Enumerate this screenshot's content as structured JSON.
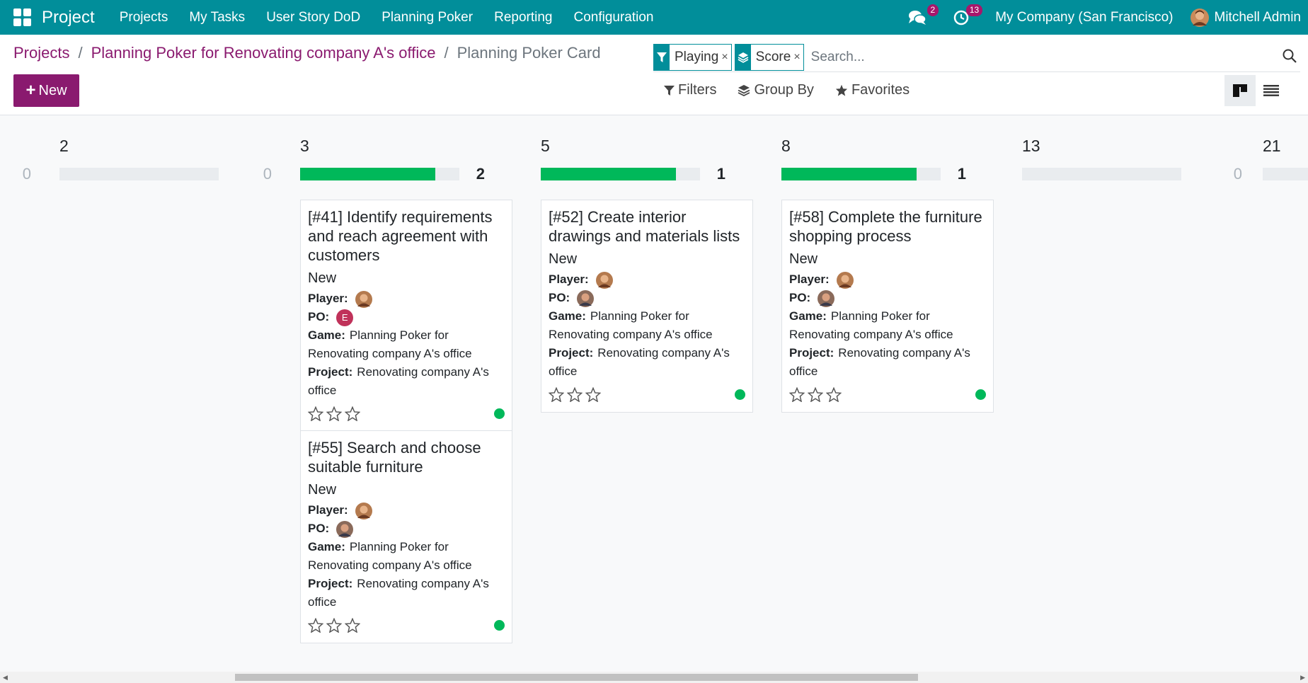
{
  "navbar": {
    "app_name": "Project",
    "menu": [
      "Projects",
      "My Tasks",
      "User Story DoD",
      "Planning Poker",
      "Reporting",
      "Configuration"
    ],
    "messages_badge": "2",
    "activities_badge": "13",
    "company": "My Company (San Francisco)",
    "user": "Mitchell Admin"
  },
  "breadcrumb": {
    "root": "Projects",
    "parent": "Planning Poker for Renovating company A's office",
    "current": "Planning Poker Card"
  },
  "search": {
    "facets": [
      "Playing",
      "Score"
    ],
    "facet_remove": "×",
    "placeholder": "Search..."
  },
  "toolbar": {
    "new_label": "New",
    "filters_label": "Filters",
    "groupby_label": "Group By",
    "favorites_label": "Favorites"
  },
  "columns": [
    {
      "title": "2",
      "count": "0",
      "progress": 0
    },
    {
      "title": "3",
      "count": "2",
      "progress": 1.0
    },
    {
      "title": "5",
      "count": "1",
      "progress": 1.0
    },
    {
      "title": "8",
      "count": "1",
      "progress": 1.0
    },
    {
      "title": "13",
      "count": "0",
      "progress": 0
    },
    {
      "title": "21",
      "count": "",
      "progress": 0
    }
  ],
  "labels": {
    "player": "Player:",
    "po": "PO:",
    "game": "Game:",
    "project": "Project:"
  },
  "cards": [
    {
      "title": "[#41] Identify requirements and reach agreement with customers",
      "stage": "New",
      "po_initial": "E",
      "game": "Planning Poker for Renovating company A's office",
      "project": "Renovating company A's office"
    },
    {
      "title": "[#55] Search and choose suitable furniture",
      "stage": "New",
      "game": "Planning Poker for Renovating company A's office",
      "project": "Renovating company A's office"
    },
    {
      "title": "[#52] Create interior drawings and materials lists",
      "stage": "New",
      "game": "Planning Poker for Renovating company A's office",
      "project": "Renovating company A's office"
    },
    {
      "title": "[#58] Complete the furniture shopping process",
      "stage": "New",
      "game": "Planning Poker for Renovating company A's office",
      "project": "Renovating company A's office"
    }
  ],
  "colors": {
    "navbar": "#018e9a",
    "primary": "#8a1a6f",
    "success": "#00b85a"
  }
}
